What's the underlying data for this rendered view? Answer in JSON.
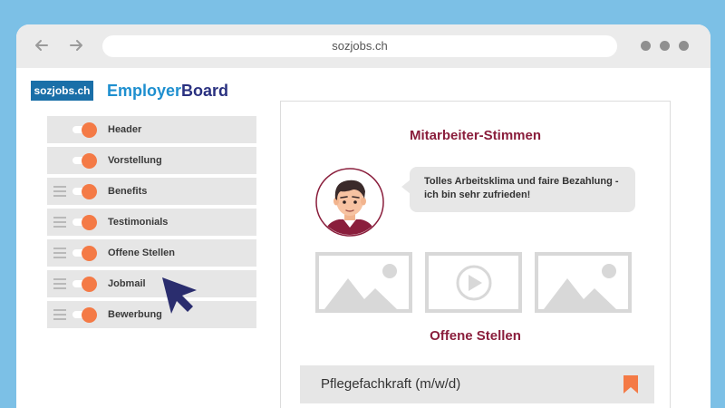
{
  "browser": {
    "url": "sozjobs.ch"
  },
  "logo": {
    "text": "sozjobs.ch"
  },
  "brand": {
    "part1": "Employer",
    "part2": "Board",
    "color1": "#1e8fcf",
    "color2": "#2a3180"
  },
  "accent_color": "#f47a46",
  "modules": [
    {
      "label": "Header",
      "enabled": true,
      "draggable": false
    },
    {
      "label": "Vorstellung",
      "enabled": true,
      "draggable": false
    },
    {
      "label": "Benefits",
      "enabled": true,
      "draggable": true
    },
    {
      "label": "Testimonials",
      "enabled": true,
      "draggable": true
    },
    {
      "label": "Offene Stellen",
      "enabled": true,
      "draggable": true
    },
    {
      "label": "Jobmail",
      "enabled": true,
      "draggable": true
    },
    {
      "label": "Bewerbung",
      "enabled": true,
      "draggable": true
    }
  ],
  "preview": {
    "testimonials_title": "Mitarbeiter-Stimmen",
    "quote_line1": "Tolles Arbeitsklima und faire Bezahlung -",
    "quote_line2": "ich bin sehr zufrieden!",
    "media_items": [
      "image-placeholder-icon",
      "video-play-icon",
      "image-placeholder-icon"
    ],
    "jobs_title": "Offene Stellen",
    "job": {
      "title": "Pflegefachkraft (m/w/d)",
      "icon": "bookmark-icon"
    }
  }
}
